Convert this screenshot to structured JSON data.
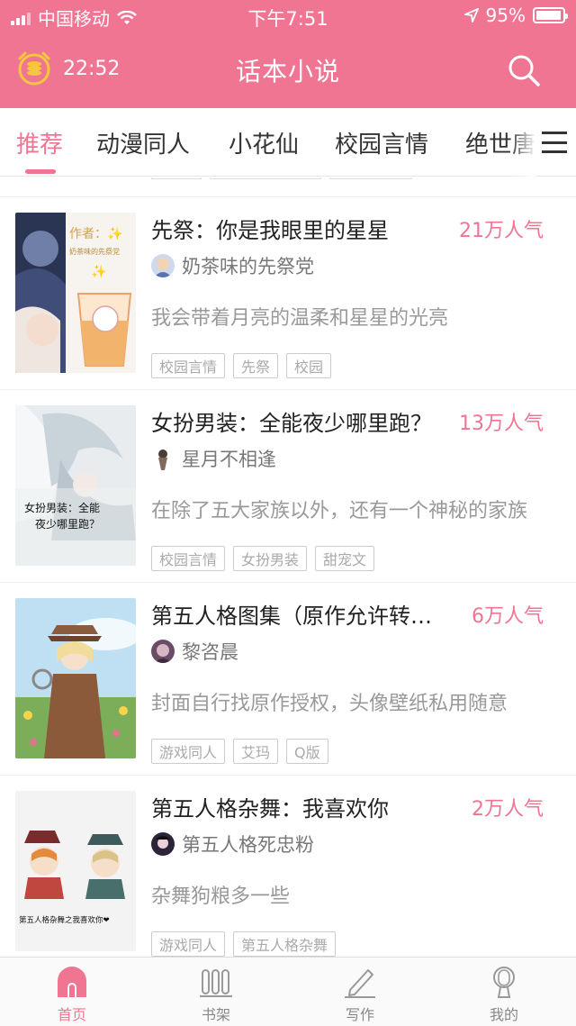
{
  "status_bar": {
    "carrier": "中国移动",
    "time": "下午7:51",
    "battery": "95%"
  },
  "header": {
    "timer": "22:52",
    "title": "话本小说"
  },
  "tabs": [
    {
      "label": "推荐"
    },
    {
      "label": "动漫同人"
    },
    {
      "label": "小花仙"
    },
    {
      "label": "校园言情"
    },
    {
      "label": "绝世唐"
    }
  ],
  "books": [
    {
      "title": "先祭：你是我眼里的星星",
      "popularity": "21万人气",
      "author": "奶茶味的先祭党",
      "description": "我会带着月亮的温柔和星星的光亮",
      "tags": [
        "校园言情",
        "先祭",
        "校园"
      ],
      "cover_text": [
        "作者：✨",
        "奶茶味的先祭党"
      ]
    },
    {
      "title": "女扮男装：全能夜少哪里跑？",
      "popularity": "13万人气",
      "author": "星月不相逢",
      "description": "在除了五大家族以外，还有一个神秘的家族",
      "tags": [
        "校园言情",
        "女扮男装",
        "甜宠文"
      ],
      "cover_text": [
        "女扮男装：全能",
        "夜少哪里跑？"
      ]
    },
    {
      "title": "第五人格图集（原作允许转载）",
      "popularity": "6万人气",
      "author": "黎咨晨",
      "description": "封面自行找原作授权，头像壁纸私用随意",
      "tags": [
        "游戏同人",
        "艾玛",
        "Q版"
      ]
    },
    {
      "title": "第五人格杂舞：我喜欢你",
      "popularity": "2万人气",
      "author": "第五人格死忠粉",
      "description": "杂舞狗粮多一些",
      "tags": [
        "游戏同人",
        "第五人格杂舞"
      ],
      "cover_text": [
        "第五人格杂舞之我喜欢你❤"
      ]
    }
  ],
  "bottom_nav": [
    {
      "label": "首页",
      "icon": "home-icon",
      "active": true
    },
    {
      "label": "书架",
      "icon": "bookshelf-icon",
      "active": false
    },
    {
      "label": "写作",
      "icon": "pencil-icon",
      "active": false
    },
    {
      "label": "我的",
      "icon": "profile-icon",
      "active": false
    }
  ],
  "colors": {
    "accent": "#f07593",
    "tag_border": "#cccccc"
  }
}
